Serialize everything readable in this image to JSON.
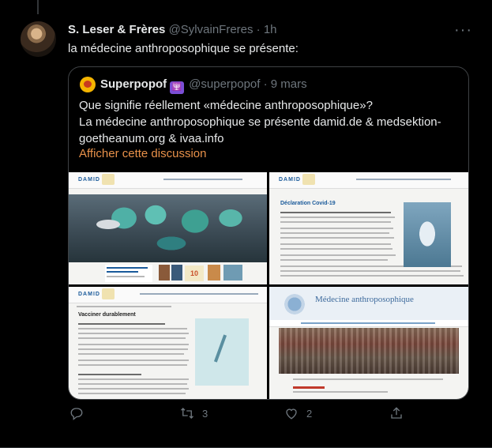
{
  "tweet": {
    "author_name": "S. Leser & Frères",
    "author_handle": "@SylvainFreres",
    "separator": "·",
    "time": "1h",
    "text": "la médecine anthroposophique se présente:",
    "more_label": "···"
  },
  "quote": {
    "author_name": "Superpopof",
    "badge": "🕎",
    "author_handle": "@superpopof",
    "separator": "·",
    "date": "9 mars",
    "line1": "Que signifie réellement «médecine anthroposophique»?",
    "line2": "La médecine anthroposophique se présente damid.de & medsektion-goetheanum.org & ivaa.info",
    "link": "Afficher cette discussion",
    "images": [
      {
        "name": "damid-homepage-screenshot",
        "logo": "DAMID",
        "badge": "10"
      },
      {
        "name": "damid-declaration-screenshot",
        "logo": "DAMID",
        "heading": "Déclaration Covid-19"
      },
      {
        "name": "damid-vaccination-screenshot",
        "logo": "DAMID",
        "heading": "Vacciner durablement"
      },
      {
        "name": "medsektion-homepage-screenshot",
        "heading": "Médecine anthroposophique"
      }
    ]
  },
  "actions": {
    "reply_count": "",
    "retweet_count": "3",
    "like_count": "2",
    "share_count": ""
  },
  "colors": {
    "background": "#000000",
    "text": "#e7e9ea",
    "muted": "#6e767d",
    "link": "#e8914a",
    "border": "#3e4144"
  }
}
